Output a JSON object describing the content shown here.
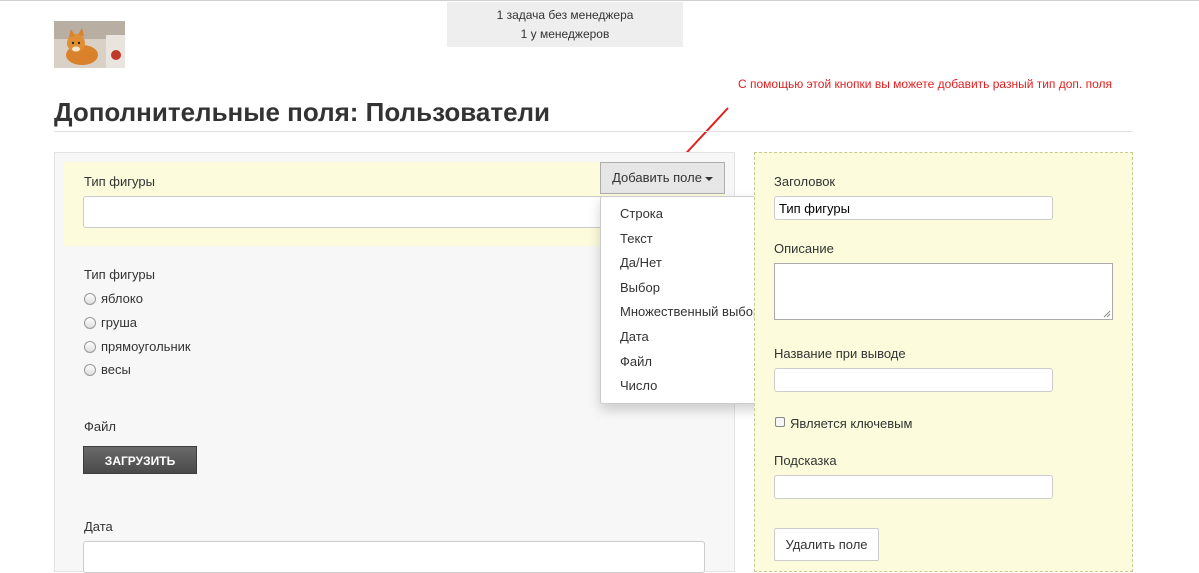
{
  "header": {
    "notice_line1": "1 задача без менеджера",
    "notice_line2": "1 у менеджеров"
  },
  "annotation": "С помощью этой кнопки вы можете добавить разный тип доп. поля",
  "page_title": "Дополнительные поля: Пользователи",
  "form": {
    "selected_field_label": "Тип фигуры",
    "selected_field_value": "",
    "add_field_button": "Добавить поле",
    "dropdown_items": [
      "Строка",
      "Текст",
      "Да/Нет",
      "Выбор",
      "Множественный выбор",
      "Дата",
      "Файл",
      "Число"
    ],
    "radio_group_label": "Тип фигуры",
    "radio_options": [
      "яблоко",
      "груша",
      "прямоугольник",
      "весы"
    ],
    "file_label": "Файл",
    "upload_button": "ЗАГРУЗИТЬ",
    "date_label": "Дата",
    "date_value": ""
  },
  "settings": {
    "title_label": "Заголовок",
    "title_value": "Тип фигуры",
    "description_label": "Описание",
    "description_value": "",
    "display_name_label": "Название при выводе",
    "display_name_value": "",
    "is_key_label": "Является ключевым",
    "is_key_checked": false,
    "hint_label": "Подсказка",
    "hint_value": "",
    "delete_button": "Удалить поле"
  },
  "colors": {
    "annotation_red": "#e02020",
    "highlight_yellow": "#fcfcdc"
  }
}
